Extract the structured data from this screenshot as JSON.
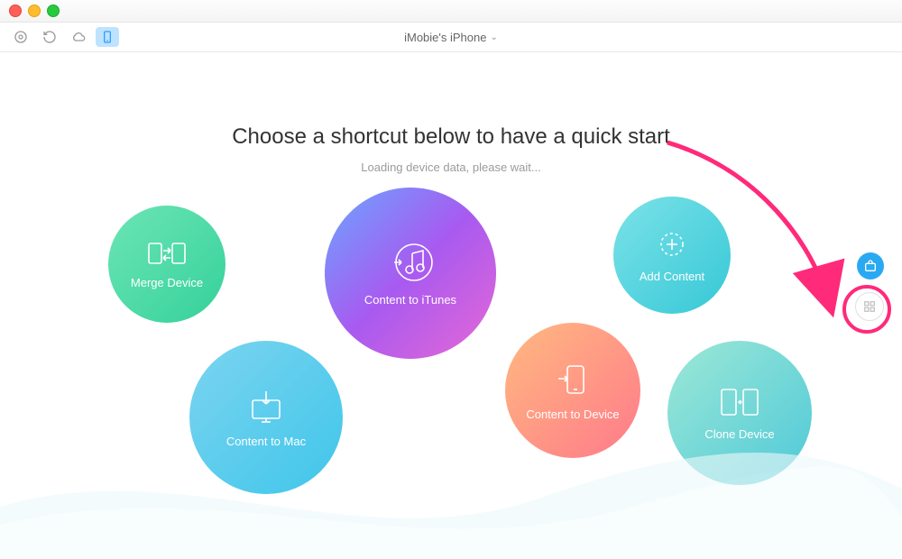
{
  "window": {
    "device_title": "iMobie's iPhone"
  },
  "toolbar": {
    "icons": [
      "music-library-icon",
      "refresh-icon",
      "cloud-icon",
      "phone-icon"
    ]
  },
  "main": {
    "heading": "Choose a shortcut below to have a quick start",
    "loading_text": "Loading device data, please wait..."
  },
  "bubbles": {
    "merge_device": "Merge Device",
    "content_to_itunes": "Content to iTunes",
    "add_content": "Add Content",
    "content_to_mac": "Content to Mac",
    "content_to_device": "Content to Device",
    "clone_device": "Clone Device"
  },
  "side": {
    "toolbox": "toolbox",
    "grid_view": "grid-view"
  },
  "colors": {
    "accent_pink": "#ff2a7a",
    "accent_blue": "#2aa9f3"
  }
}
